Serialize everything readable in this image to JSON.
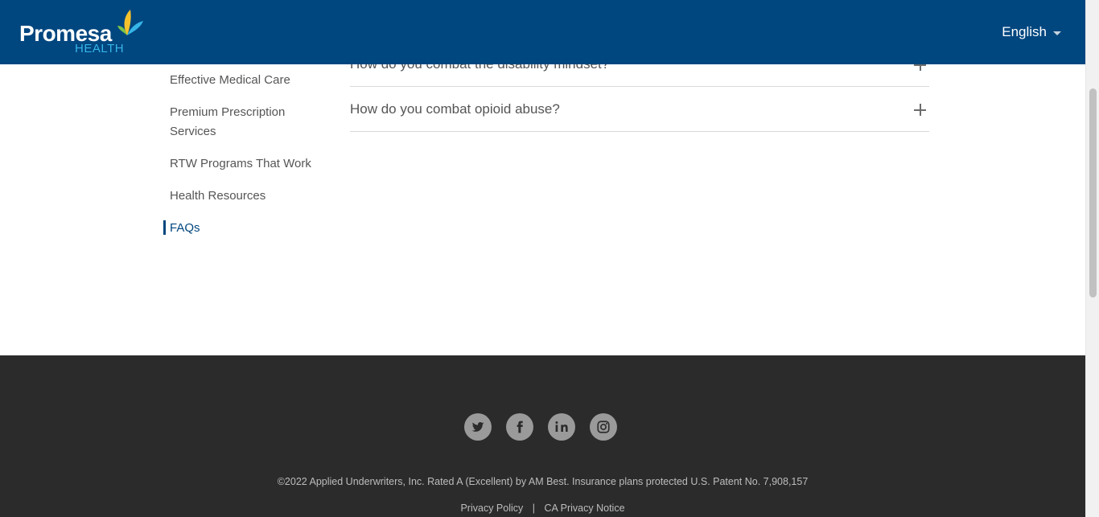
{
  "header": {
    "logo_text": "Promesa",
    "logo_sub": "HEALTH",
    "language": "English"
  },
  "sidenav": {
    "items": [
      {
        "label": "Effective Medical Care",
        "active": false
      },
      {
        "label": "Premium Prescription Services",
        "active": false
      },
      {
        "label": "RTW Programs That Work",
        "active": false
      },
      {
        "label": "Health Resources",
        "active": false
      },
      {
        "label": "FAQs",
        "active": true
      }
    ]
  },
  "faq": {
    "items": [
      {
        "question": "How do you combat the disability mindset?"
      },
      {
        "question": "How do you combat opioid abuse?"
      }
    ]
  },
  "footer": {
    "socials": [
      "twitter-icon",
      "facebook-icon",
      "linkedin-icon",
      "instagram-icon"
    ],
    "copyright": "©2022 Applied Underwriters, Inc. Rated A (Excellent) by AM Best. Insurance plans protected U.S. Patent No. 7,908,157",
    "links": {
      "privacy": "Privacy Policy",
      "separator": "|",
      "ca_privacy": "CA Privacy Notice"
    }
  },
  "colors": {
    "header_bg": "#00467f",
    "footer_bg": "#2b2b2b",
    "accent": "#00467f",
    "logo_sub": "#36b5e8"
  }
}
